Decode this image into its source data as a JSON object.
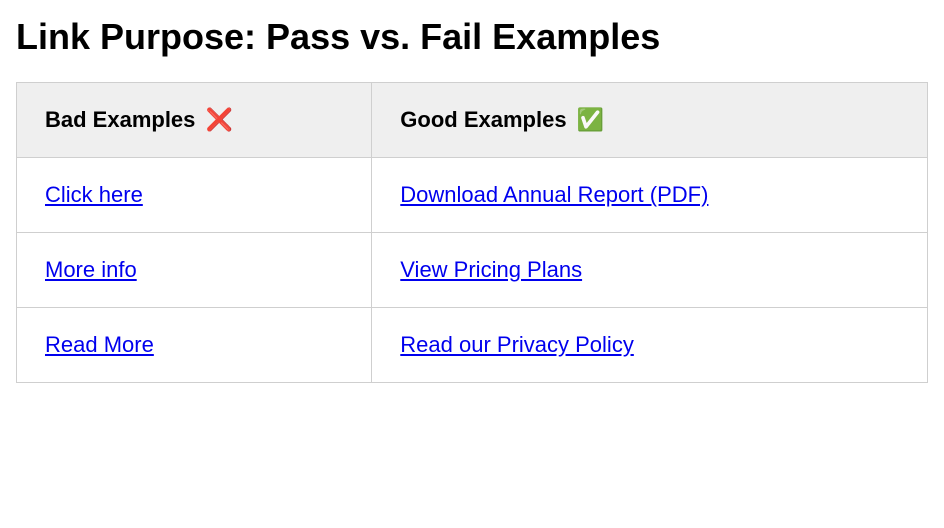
{
  "title": "Link Purpose: Pass vs. Fail Examples",
  "table": {
    "headers": {
      "bad": "Bad Examples",
      "bad_icon": "❌",
      "good": "Good Examples",
      "good_icon": "✅"
    },
    "rows": [
      {
        "bad": "Click here",
        "good": "Download Annual Report (PDF)"
      },
      {
        "bad": "More info",
        "good": "View Pricing Plans"
      },
      {
        "bad": "Read More",
        "good": "Read our Privacy Policy"
      }
    ]
  }
}
